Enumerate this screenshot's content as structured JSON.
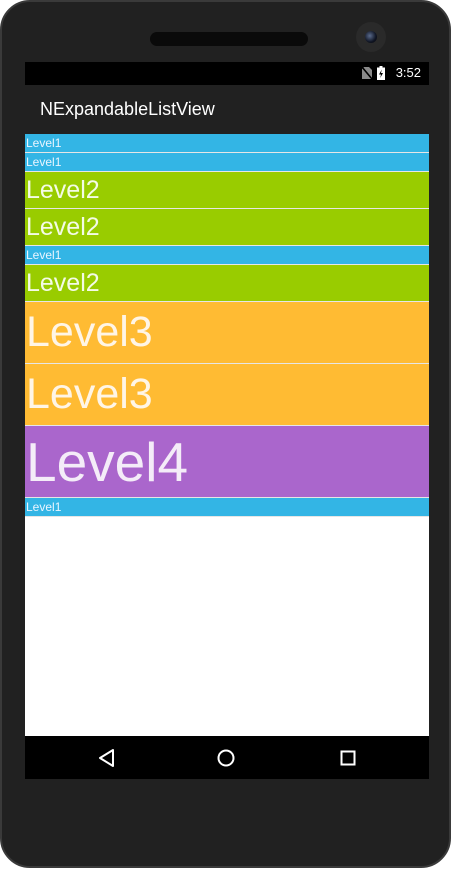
{
  "status_bar": {
    "time": "3:52",
    "icons": [
      "no-sim-icon",
      "battery-charging-icon"
    ]
  },
  "app_bar": {
    "title": "NExpandableListView"
  },
  "list": {
    "items": [
      {
        "level": 1,
        "label": "Level1",
        "color": "#33b5e5"
      },
      {
        "level": 1,
        "label": "Level1",
        "color": "#33b5e5"
      },
      {
        "level": 2,
        "label": "Level2",
        "color": "#99cc00"
      },
      {
        "level": 2,
        "label": "Level2",
        "color": "#99cc00"
      },
      {
        "level": 1,
        "label": "Level1",
        "color": "#33b5e5"
      },
      {
        "level": 2,
        "label": "Level2",
        "color": "#99cc00"
      },
      {
        "level": 3,
        "label": "Level3",
        "color": "#ffbb33"
      },
      {
        "level": 3,
        "label": "Level3",
        "color": "#ffbb33"
      },
      {
        "level": 4,
        "label": "Level4",
        "color": "#aa66cc"
      },
      {
        "level": 1,
        "label": "Level1",
        "color": "#33b5e5"
      }
    ]
  },
  "nav_bar": {
    "buttons": [
      "back-icon",
      "home-icon",
      "recents-icon"
    ]
  }
}
